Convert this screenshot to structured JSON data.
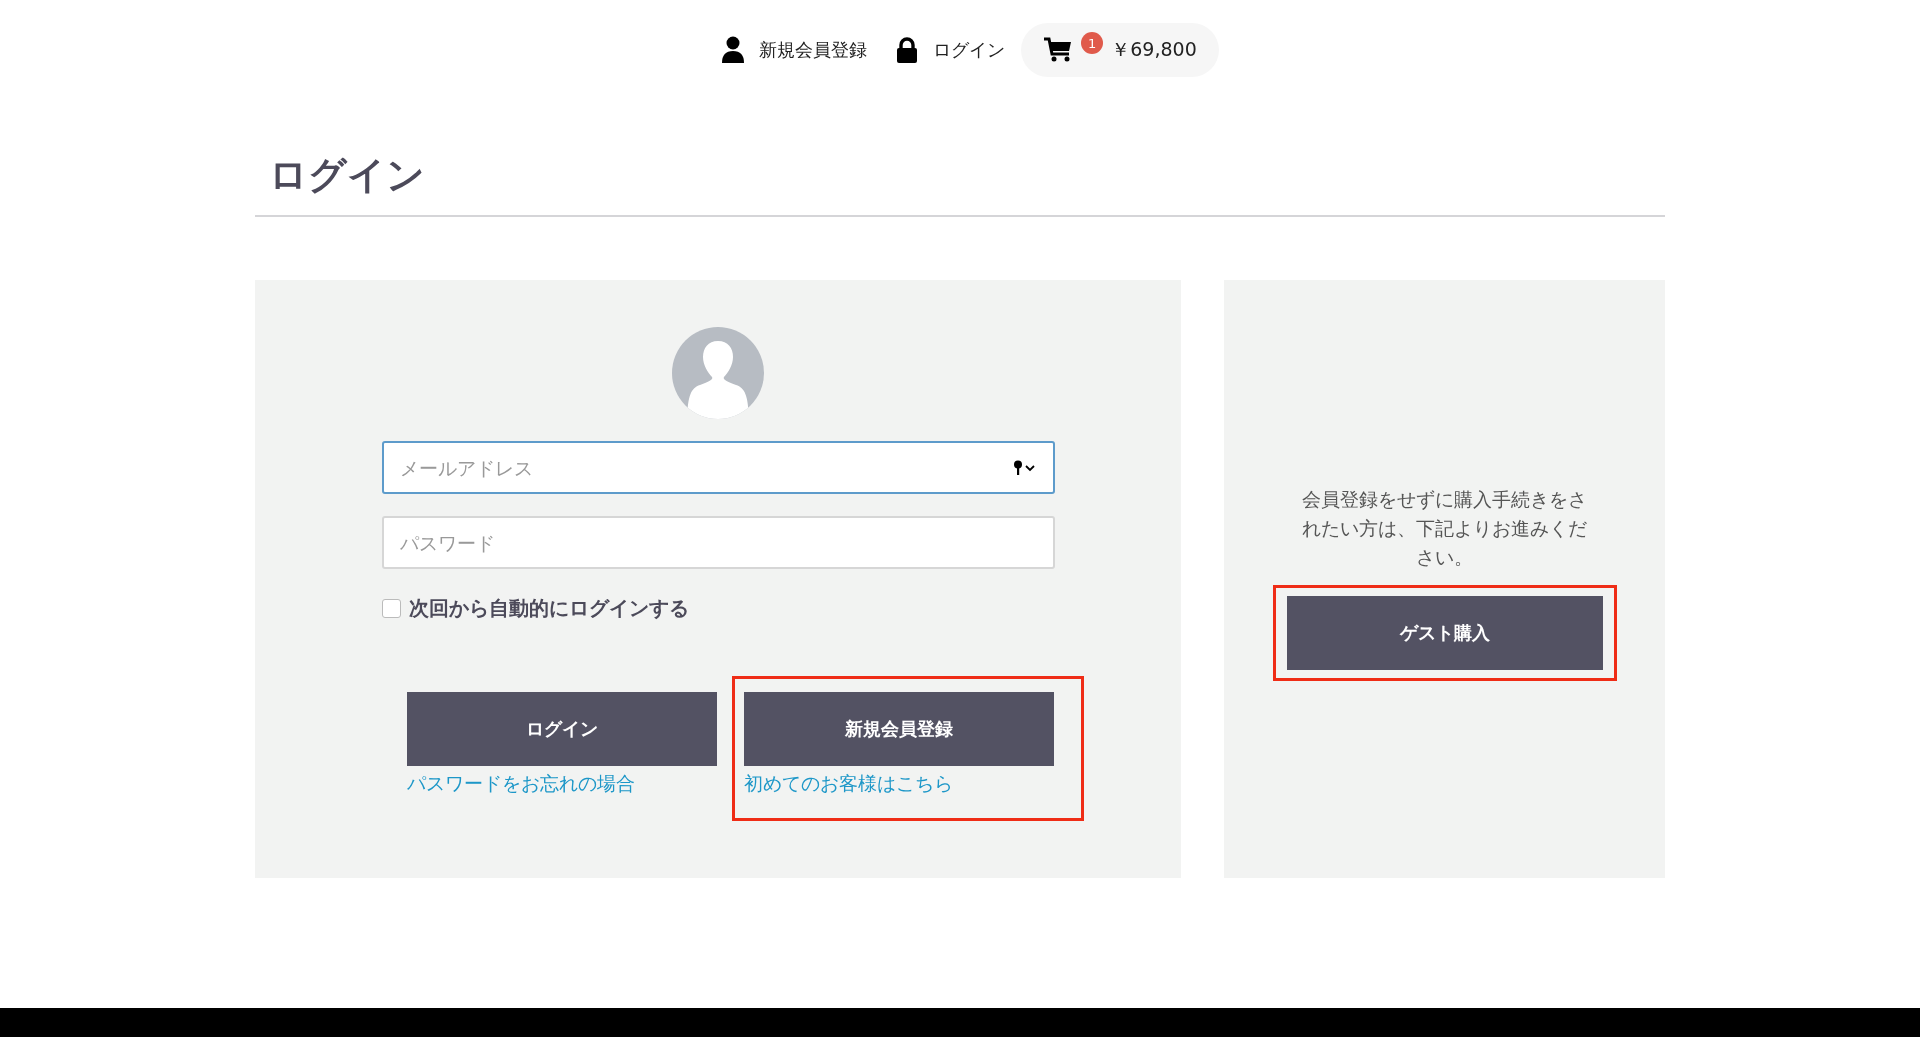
{
  "header": {
    "nav": [
      {
        "kind": "person",
        "label": "新規会員登録"
      },
      {
        "kind": "lock",
        "label": "ログイン"
      }
    ],
    "cart": {
      "badge": "1",
      "total": "￥69,800"
    }
  },
  "page_title": "ログイン",
  "login_panel": {
    "email": {
      "placeholder": "メールアドレス"
    },
    "password": {
      "placeholder": "パスワード"
    },
    "remember": {
      "label": "次回から自動的にログインする",
      "checked": false
    },
    "actions": [
      {
        "button": "ログイン",
        "link": "パスワードをお忘れの場合",
        "highlighted": false
      },
      {
        "button": "新規会員登録",
        "link": "初めてのお客様はこちら",
        "highlighted": true
      }
    ]
  },
  "guest_panel": {
    "text": "会員登録をせずに購入手続きをされたい方は、下記よりお進みください。",
    "button": "ゲスト購入",
    "highlighted": true
  }
}
